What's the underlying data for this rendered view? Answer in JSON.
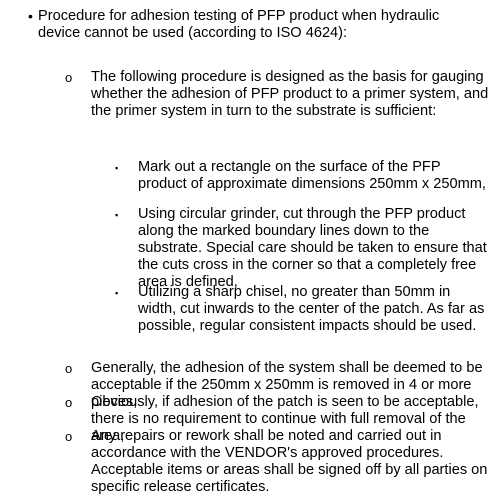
{
  "markers": {
    "level1": "•",
    "level2": "o",
    "level3": "▪"
  },
  "level1": {
    "text": "Procedure for adhesion testing of PFP product when hydraulic device cannot be used (according to ISO 4624):"
  },
  "intro": {
    "text": "The following procedure is designed as the basis for gauging whether the adhesion of PFP product to a primer system, and the primer system in turn to the substrate is sufficient:"
  },
  "steps": [
    {
      "text": "Mark out a rectangle on the surface of the PFP product of approximate dimensions 250mm x 250mm,"
    },
    {
      "text": "Using circular grinder, cut through the PFP product along the marked boundary lines down to the substrate. Special care should be taken to ensure that the cuts cross in the corner so that a completely free area is defined,"
    },
    {
      "text": "Utilizing a sharp chisel, no greater than 50mm in width, cut inwards to the center of the patch. As far as possible, regular consistent impacts should be used."
    }
  ],
  "criteria": [
    {
      "text": "Generally, the adhesion of the system shall be deemed to be acceptable if the 250mm x 250mm is removed in 4 or more pieces,"
    },
    {
      "text": "Obviously, if adhesion of the patch is seen to be acceptable, there is no requirement to continue with full removal of the area,"
    },
    {
      "text": "Any repairs or rework shall be noted and carried out in accordance with the VENDOR's approved procedures. Acceptable items or areas shall be signed off by all parties on specific release certificates."
    }
  ]
}
